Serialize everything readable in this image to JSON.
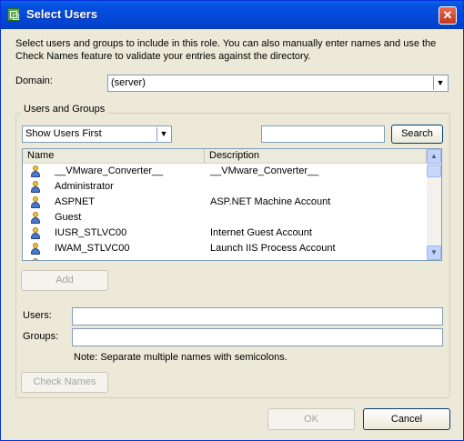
{
  "window": {
    "title": "Select Users",
    "close_glyph": "✕",
    "icon": "vmware-icon"
  },
  "intro_text": "Select users and groups to include in this role. You can also manually enter names and use the Check Names feature to validate your entries against the directory.",
  "domain": {
    "label": "Domain:",
    "value": "(server)"
  },
  "users_and_groups": {
    "legend": "Users and Groups",
    "filter_value": "Show Users First",
    "search_value": "",
    "search_label": "Search",
    "columns": {
      "name": "Name",
      "description": "Description"
    },
    "rows": [
      {
        "name": "__VMware_Converter__",
        "description": "__VMware_Converter__"
      },
      {
        "name": "Administrator",
        "description": ""
      },
      {
        "name": "ASPNET",
        "description": "ASP.NET Machine Account"
      },
      {
        "name": "Guest",
        "description": ""
      },
      {
        "name": "IUSR_STLVC00",
        "description": "Internet Guest Account"
      },
      {
        "name": "IWAM_STLVC00",
        "description": "Launch IIS Process Account"
      }
    ],
    "add_label": "Add",
    "users_label": "Users:",
    "users_value": "",
    "groups_label": "Groups:",
    "groups_value": "",
    "note": "Note: Separate multiple names with semicolons.",
    "check_names_label": "Check Names"
  },
  "footer": {
    "ok_label": "OK",
    "cancel_label": "Cancel"
  },
  "colors": {
    "titlebar": "#0348d8",
    "dialog_bg": "#ece9d8",
    "border": "#7f9db9"
  }
}
